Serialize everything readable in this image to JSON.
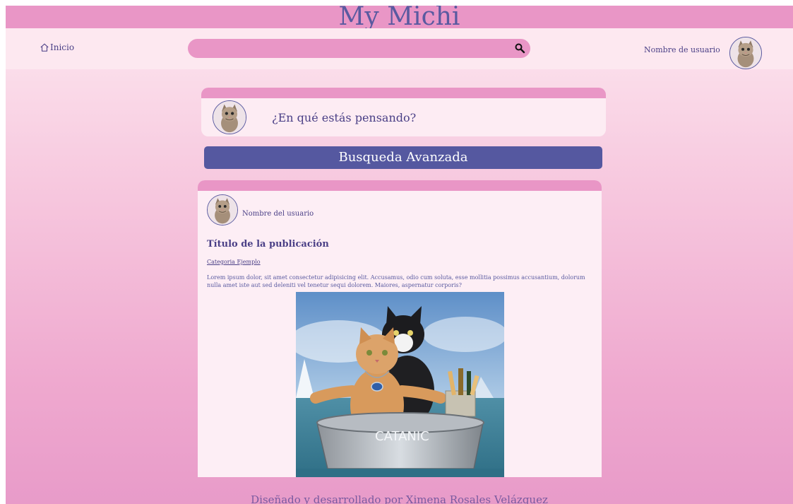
{
  "app": {
    "title": "My Michi"
  },
  "nav": {
    "home_label": "Inicio",
    "home_icon": "home-icon",
    "search_placeholder": "",
    "search_icon": "search-icon",
    "username": "Nombre de usuario"
  },
  "composer": {
    "prompt": "¿En qué estás pensando?"
  },
  "advanced_search": {
    "label": "Busqueda Avanzada"
  },
  "post": {
    "author": "Nombre del usuario",
    "title": "Título de la publicación",
    "category": "Categoria Ejemplo",
    "body": "Lorem ipsum dolor, sit amet consectetur adipisicing elit. Accusamus, odio cum soluta, esse mollitia possimus accusantium, dolorum nulla amet iste aut sed deleniti vel tenetur sequi dolorem. Maiores, aspernatur corporis?",
    "image_caption": "CATANIC"
  },
  "footer": {
    "credit": "Diseñado y desarrollado por Ximena Rosales Velázquez"
  },
  "colors": {
    "header_pink": "#e996c6",
    "navbar_bg": "#fde8f0",
    "accent_purple": "#5558a0",
    "text_purple": "#4a3f86"
  }
}
